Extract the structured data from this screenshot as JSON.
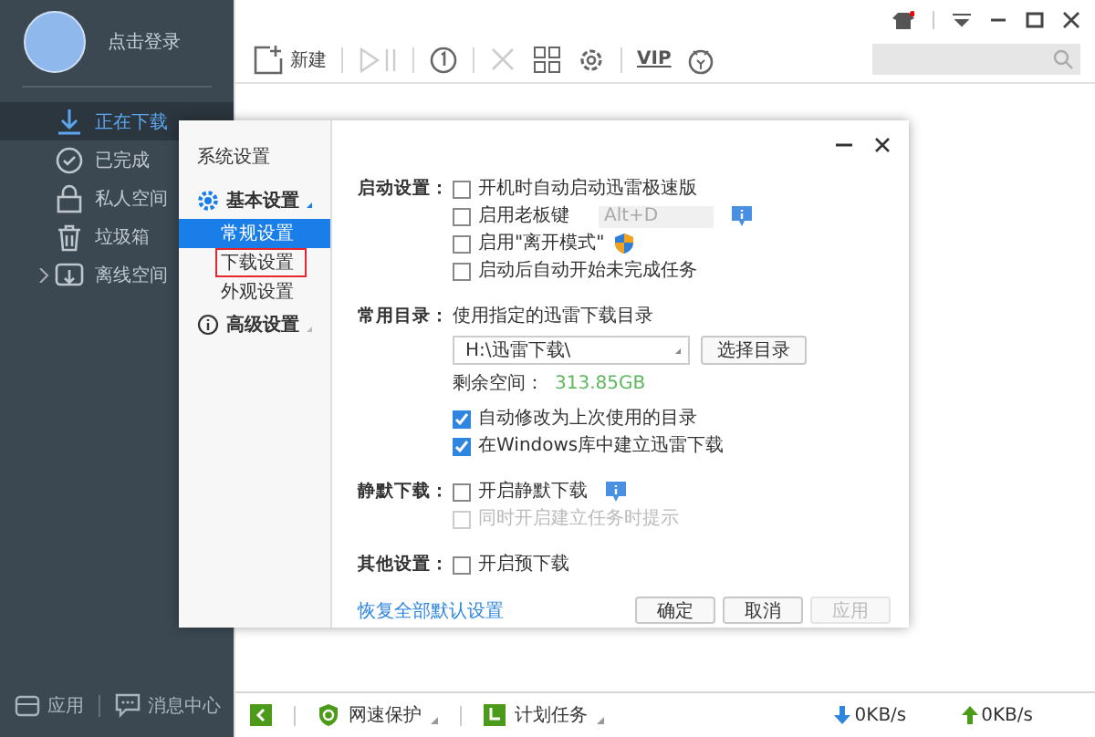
{
  "sidebar": {
    "user": {
      "name": "点击登录"
    },
    "nav": [
      {
        "label": "正在下载",
        "selected": true
      },
      {
        "label": "已完成",
        "selected": false
      },
      {
        "label": "私人空间",
        "selected": false
      },
      {
        "label": "垃圾箱",
        "selected": false
      },
      {
        "label": "离线空间",
        "selected": false,
        "expanded": false
      }
    ],
    "footer": [
      {
        "label": "应用"
      },
      {
        "label": "消息中心"
      }
    ]
  },
  "toolbar": {
    "new_label": "新建",
    "vip_label": "VIP"
  },
  "dialog": {
    "title": "系统设置",
    "nav": [
      {
        "label": "基本设置",
        "expanded": true,
        "children": [
          {
            "label": "常规设置",
            "selected": true,
            "outlined": false
          },
          {
            "label": "下载设置",
            "selected": false,
            "outlined": true
          },
          {
            "label": "外观设置",
            "selected": false,
            "outlined": false
          }
        ]
      },
      {
        "label": "高级设置",
        "expanded": false
      }
    ],
    "sections": [
      {
        "label": "启动设置：",
        "rows": [
          {
            "kind": "checkbox",
            "label": "开机时自动启动迅雷极速版",
            "checked": false,
            "disabled": false
          },
          {
            "kind": "checkbox",
            "label": "启用老板键",
            "checked": false,
            "disabled": false,
            "field": "Alt+D",
            "info": true
          },
          {
            "kind": "checkbox",
            "label": "启用\"离开模式\"",
            "checked": false,
            "disabled": false,
            "shield": true
          },
          {
            "kind": "checkbox",
            "label": "启动后自动开始未完成任务",
            "checked": false,
            "disabled": false
          }
        ]
      },
      {
        "label": "常用目录：",
        "rows": [
          {
            "kind": "text",
            "label": "使用指定的迅雷下载目录"
          },
          {
            "kind": "path",
            "value": "H:\\迅雷下载\\",
            "button": "选择目录"
          },
          {
            "kind": "space",
            "label": "剩余空间：",
            "value": "313.85GB"
          },
          {
            "kind": "checkbox",
            "label": "自动修改为上次使用的目录",
            "checked": true,
            "disabled": false
          },
          {
            "kind": "checkbox",
            "label": "在Windows库中建立迅雷下载",
            "checked": true,
            "disabled": false
          }
        ]
      },
      {
        "label": "静默下载：",
        "rows": [
          {
            "kind": "checkbox",
            "label": "开启静默下载",
            "checked": false,
            "disabled": false,
            "info": true
          },
          {
            "kind": "checkbox",
            "label": "同时开启建立任务时提示",
            "checked": false,
            "disabled": true
          }
        ]
      },
      {
        "label": "其他设置：",
        "rows": [
          {
            "kind": "checkbox",
            "label": "开启预下载",
            "checked": false,
            "disabled": false
          }
        ]
      }
    ],
    "reset_link": "恢复全部默认设置",
    "buttons": [
      {
        "label": "确定",
        "disabled": false
      },
      {
        "label": "取消",
        "disabled": false
      },
      {
        "label": "应用",
        "disabled": true
      }
    ]
  },
  "status_bar": {
    "items": [
      {
        "label": "网速保护"
      },
      {
        "label": "计划任务"
      }
    ],
    "download_speed": "0KB/s",
    "upload_speed": "0KB/s"
  }
}
